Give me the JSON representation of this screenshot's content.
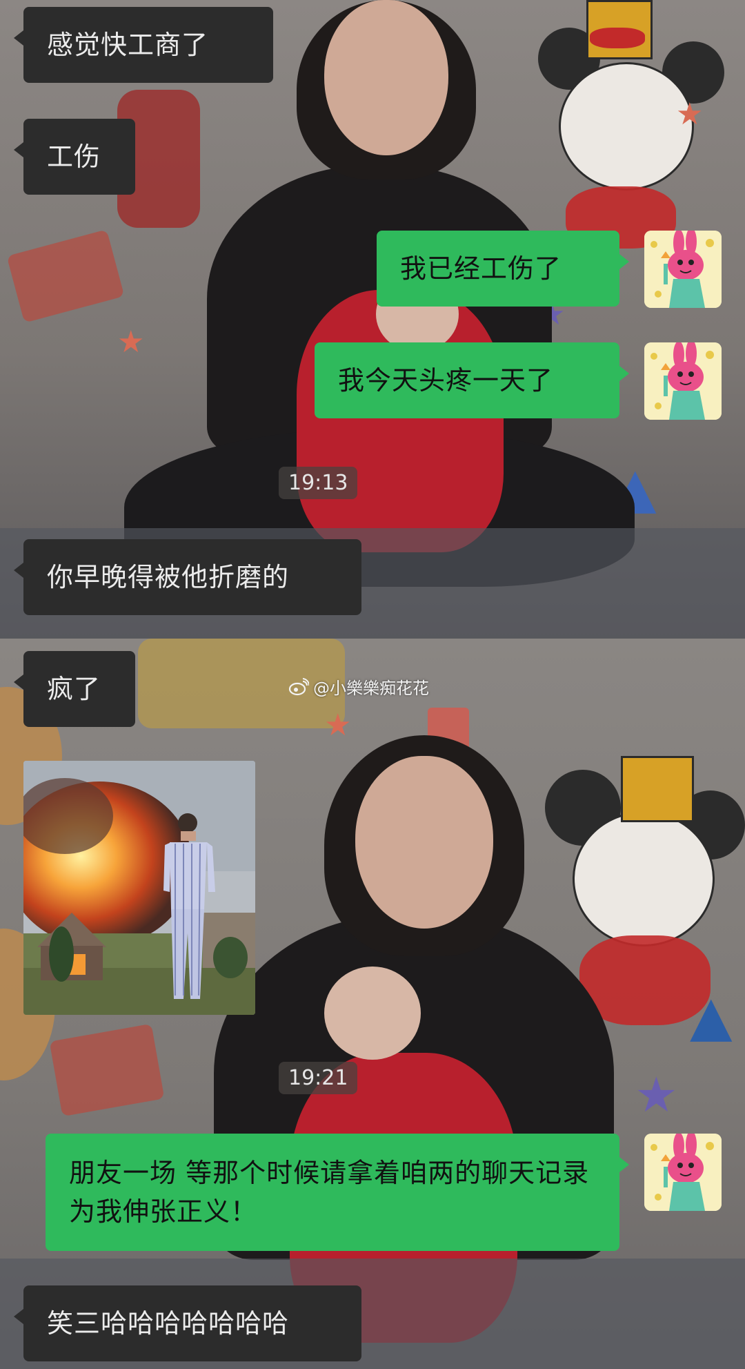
{
  "colors": {
    "incoming_bubble": "#2c2c2c",
    "outgoing_bubble": "#2fba5c",
    "timestamp_bg": "#4a4644"
  },
  "watermark": {
    "icon": "weibo-logo-icon",
    "handle": "@小樂樂痴花花"
  },
  "messages": [
    {
      "side": "in",
      "text": "感觉快工商了"
    },
    {
      "side": "in",
      "text": "工伤"
    },
    {
      "side": "out",
      "text": "我已经工伤了"
    },
    {
      "side": "out",
      "text": "我今天头疼一天了"
    },
    {
      "type": "time",
      "text": "19:13"
    },
    {
      "side": "in",
      "text": "你早晚得被他折磨的"
    },
    {
      "side": "in",
      "text": "疯了"
    },
    {
      "side": "in",
      "type": "image",
      "image": "meme-man-pajamas-house-fire"
    },
    {
      "type": "time",
      "text": "19:21"
    },
    {
      "side": "out",
      "text": "朋友一场 等那个时候请拿着咱两的聊天记录为我伸张正义！"
    },
    {
      "side": "in",
      "text": "笑三哈哈哈哈哈哈哈"
    }
  ],
  "self_avatar": "pink-rabbit-statue-of-liberty-avatar"
}
